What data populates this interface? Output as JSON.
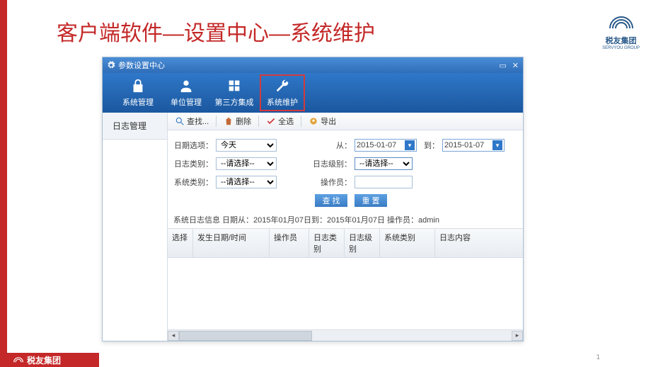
{
  "page": {
    "title": "客户端软件—设置中心—系统维护",
    "number": "1",
    "brand": {
      "name": "税友集团",
      "sub": "SERVYOU GROUP"
    }
  },
  "window": {
    "title": "参数设置中心",
    "tabs": [
      {
        "label": "系统管理"
      },
      {
        "label": "单位管理"
      },
      {
        "label": "第三方集成"
      },
      {
        "label": "系统维护",
        "active": true
      }
    ],
    "controls": {
      "min": "▭",
      "close": "✕"
    }
  },
  "sidebar": {
    "items": [
      {
        "label": "日志管理"
      }
    ]
  },
  "toolbar": {
    "search": "查找...",
    "delete": "删除",
    "selectAll": "全选",
    "export": "导出"
  },
  "filters": {
    "dateOption": {
      "label": "日期选项：",
      "value": "今天"
    },
    "from": {
      "label": "从：",
      "value": "2015-01-07"
    },
    "to": {
      "label": "到：",
      "value": "2015-01-07"
    },
    "logType": {
      "label": "日志类别：",
      "value": "--请选择--"
    },
    "logLevel": {
      "label": "日志级别：",
      "value": "--请选择--"
    },
    "sysType": {
      "label": "系统类别：",
      "value": "--请选择--"
    },
    "operator": {
      "label": "操作员：",
      "value": ""
    },
    "buttons": {
      "search": "查 找",
      "reset": "重 置"
    }
  },
  "status": "系统日志信息  日期从：2015年01月07日到：2015年01月07日   操作员：admin",
  "table": {
    "columns": [
      "选择",
      "发生日期/时间",
      "操作员",
      "日志类别",
      "日志级别",
      "系统类别",
      "日志内容"
    ],
    "widths": [
      36,
      108,
      56,
      50,
      50,
      78,
      118
    ]
  }
}
